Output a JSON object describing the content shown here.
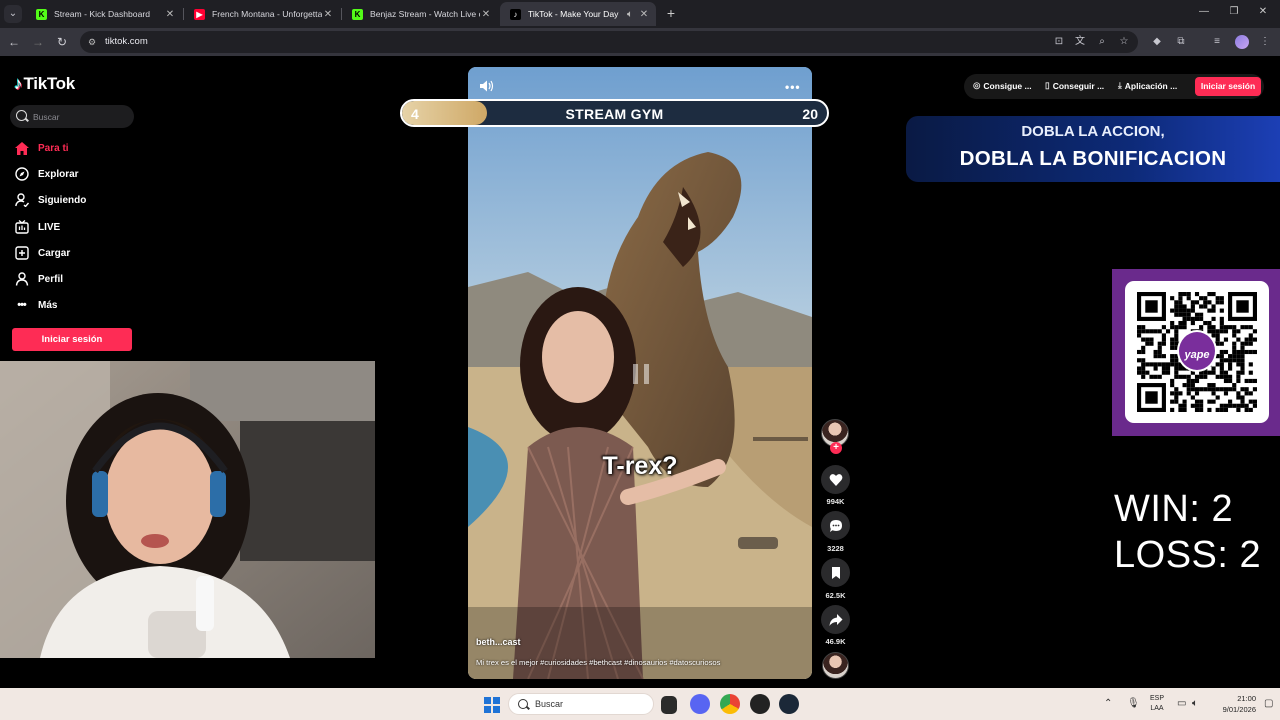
{
  "browser": {
    "tabs": [
      {
        "title": "Stream - Kick Dashboard",
        "active": false
      },
      {
        "title": "French Montana - Unforgettable",
        "active": false
      },
      {
        "title": "Benjaz Stream - Watch Live on",
        "active": false
      },
      {
        "title": "TikTok - Make Your Day",
        "active": true
      }
    ],
    "url": "tiktok.com"
  },
  "tiktok": {
    "brand": "TikTok",
    "search_placeholder": "Buscar",
    "nav": [
      {
        "label": "Para ti",
        "icon": "home-icon",
        "active": true
      },
      {
        "label": "Explorar",
        "icon": "compass-icon",
        "active": false
      },
      {
        "label": "Siguiendo",
        "icon": "following-icon",
        "active": false
      },
      {
        "label": "LIVE",
        "icon": "live-icon",
        "active": false
      },
      {
        "label": "Cargar",
        "icon": "upload-icon",
        "active": false
      },
      {
        "label": "Perfil",
        "icon": "profile-icon",
        "active": false
      },
      {
        "label": "Más",
        "icon": "more-icon",
        "active": false
      }
    ],
    "login_label": "Iniciar sesión",
    "header_links": [
      "Consigue ...",
      "Conseguir ...",
      "Aplicación ..."
    ],
    "header_login": "Iniciar sesión"
  },
  "video": {
    "caption_overlay": "T-rex?",
    "author": "beth...cast",
    "description": "Mi trex es el mejor #curiosidades #bethcast #dinosaurios #datoscuriosos",
    "likes": "994K",
    "comments": "3228",
    "saves": "62.5K",
    "shares": "46.9K"
  },
  "overlay": {
    "gym": {
      "left_value": "4",
      "title": "STREAM GYM",
      "right_value": "20",
      "progress": 0.2
    },
    "promo_line1": "DOBLA LA ACCION,",
    "promo_line2": "DOBLA LA BONIFICACION",
    "qr_badge": "yape",
    "win_label": "WIN: 2",
    "loss_label": "LOSS: 2"
  },
  "taskbar": {
    "search_label": "Buscar",
    "lang1": "ESP",
    "lang2": "LAA",
    "time": "21:00",
    "date": "9/01/2026"
  },
  "colors": {
    "tiktok_red": "#fe2c55",
    "browser_dark": "#1f1f24",
    "gym_fill": "#cfa866",
    "qr_purple": "#6a2a8c"
  }
}
